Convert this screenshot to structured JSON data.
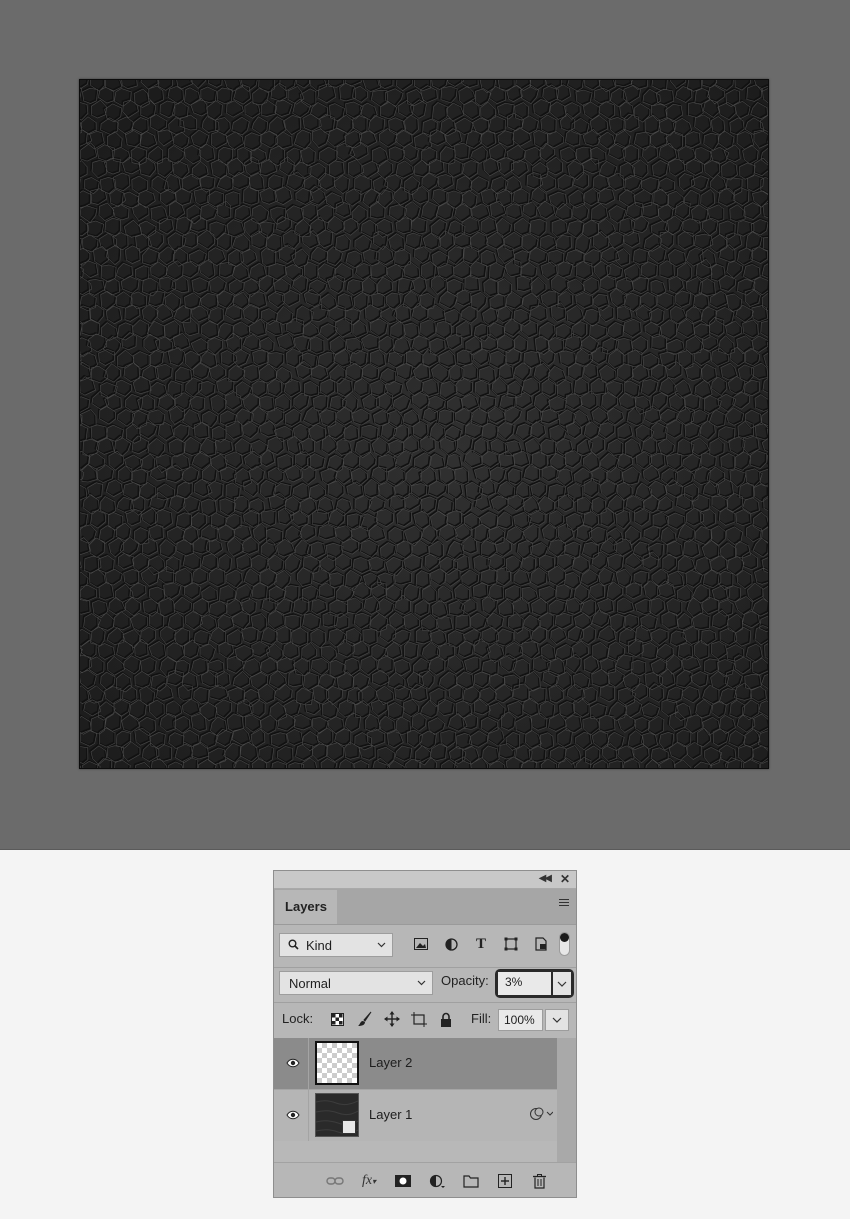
{
  "panel": {
    "tab_label": "Layers",
    "kind_filter": "Kind",
    "blend_mode": "Normal",
    "opacity_label": "Opacity:",
    "opacity_value": "3%",
    "lock_label": "Lock:",
    "fill_label": "Fill:",
    "fill_value": "100%"
  },
  "layers": [
    {
      "name": "Layer 2",
      "selected": true
    },
    {
      "name": "Layer 1",
      "selected": false
    }
  ],
  "icons": {
    "kind_filters": [
      "image-filter-icon",
      "adjustment-filter-icon",
      "type-filter-icon",
      "shape-filter-icon",
      "smart-object-filter-icon"
    ],
    "lock": [
      "lock-transparent-pixels-icon",
      "lock-image-pixels-icon",
      "lock-position-icon",
      "lock-artboard-icon",
      "lock-all-icon"
    ],
    "footer": [
      "link-layers-icon",
      "fx-icon",
      "add-mask-icon",
      "adjustment-layer-icon",
      "new-group-icon",
      "new-layer-icon",
      "delete-layer-icon"
    ]
  },
  "colors": {
    "canvas_bg": "#6b6b6b",
    "panel_bg": "#b7b7b7",
    "selected_layer": "#8b8b8b"
  }
}
